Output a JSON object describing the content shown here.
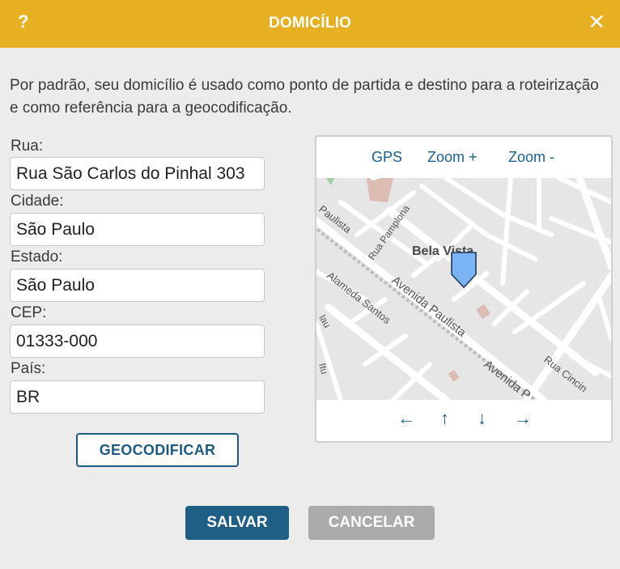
{
  "header": {
    "help_label": "?",
    "title": "DOMICÍLIO",
    "close_label": "✕"
  },
  "intro": "Por padrão, seu domicílio é usado como ponto de partida e destino para a roteirização e como referência para a geocodificação.",
  "form": {
    "street_label": "Rua:",
    "street_value": "Rua São Carlos do Pinhal 303",
    "city_label": "Cidade:",
    "city_value": "São Paulo",
    "state_label": "Estado:",
    "state_value": "São Paulo",
    "zip_label": "CEP:",
    "zip_value": "01333-000",
    "country_label": "País:",
    "country_value": "BR"
  },
  "geocode_label": "GEOCODIFICAR",
  "map": {
    "gps_label": "GPS",
    "zoom_in_label": "Zoom +",
    "zoom_out_label": "Zoom -",
    "street_names": {
      "bela_vista": "Bela Vista",
      "paulista_top": "Paulista",
      "rua_pamplona": "Rua Pamplona",
      "alameda_santos": "Alameda Santos",
      "avenida_paulista": "Avenida Paulista",
      "avenida_p": "Avenida P",
      "rua_cincin": "Rua Cincin",
      "lau": "lau",
      "itu": "Itu"
    },
    "nav": {
      "left": "←",
      "up": "↑",
      "down": "↓",
      "right": "→"
    }
  },
  "buttons": {
    "save": "SALVAR",
    "cancel": "CANCELAR"
  },
  "colors": {
    "header": "#e7b022",
    "primary": "#1f5f85",
    "link": "#1d5f8c",
    "cancel": "#ababab",
    "pin": "#7ab4f5"
  }
}
